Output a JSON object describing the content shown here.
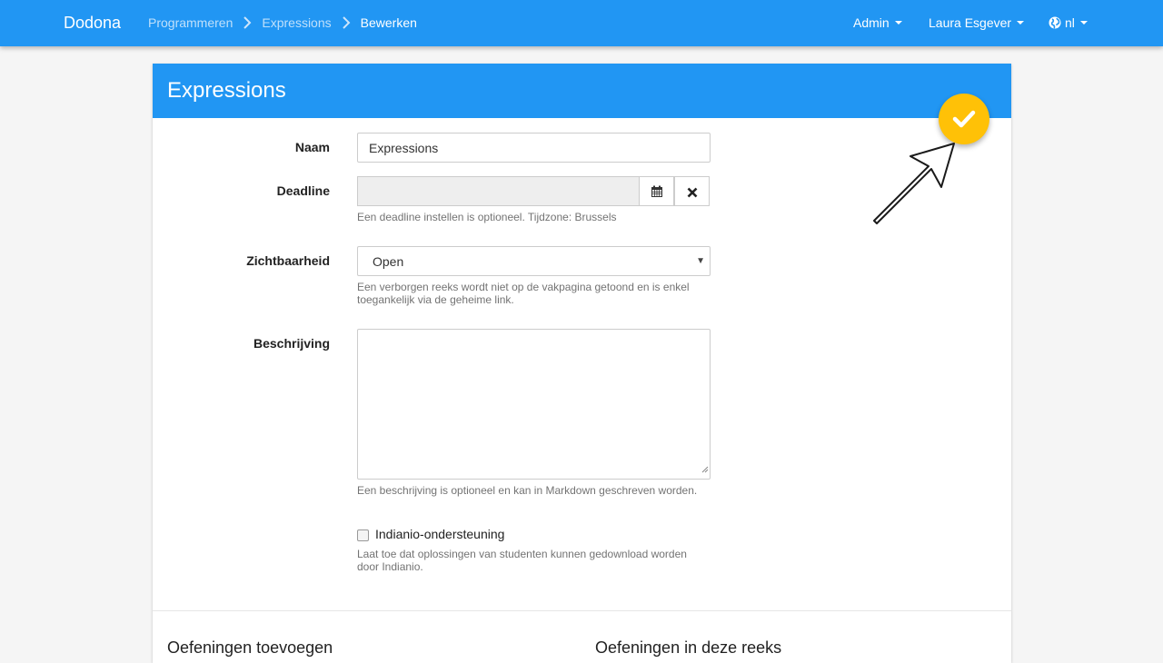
{
  "navbar": {
    "brand": "Dodona",
    "breadcrumbs": [
      "Programmeren",
      "Expressions"
    ],
    "current": "Bewerken",
    "menus": [
      {
        "label": "Admin"
      },
      {
        "label": "Laura Esgever"
      },
      {
        "label": "nl",
        "icon": "globe-icon"
      }
    ]
  },
  "card": {
    "title": "Expressions",
    "save_icon": "checkmark-icon",
    "fields": {
      "name": {
        "label": "Naam",
        "value": "Expressions"
      },
      "deadline": {
        "label": "Deadline",
        "value": "",
        "help": "Een deadline instellen is optioneel. Tijdzone: Brussels"
      },
      "visibility": {
        "label": "Zichtbaarheid",
        "value": "Open",
        "help": "Een verborgen reeks wordt niet op de vakpagina getoond en is enkel toegankelijk via de geheime link."
      },
      "description": {
        "label": "Beschrijving",
        "value": "",
        "help": "Een beschrijving is optioneel en kan in Markdown geschreven worden."
      },
      "indianio": {
        "label": "Indianio-ondersteuning",
        "checked": false,
        "help": "Laat toe dat oplossingen van studenten kunnen gedownload worden door Indianio."
      }
    },
    "sections": [
      "Oefeningen toevoegen",
      "Oefeningen in deze reeks"
    ]
  },
  "colors": {
    "primary": "#2196f3",
    "accent": "#ffc107",
    "background": "#f5f5f5"
  }
}
